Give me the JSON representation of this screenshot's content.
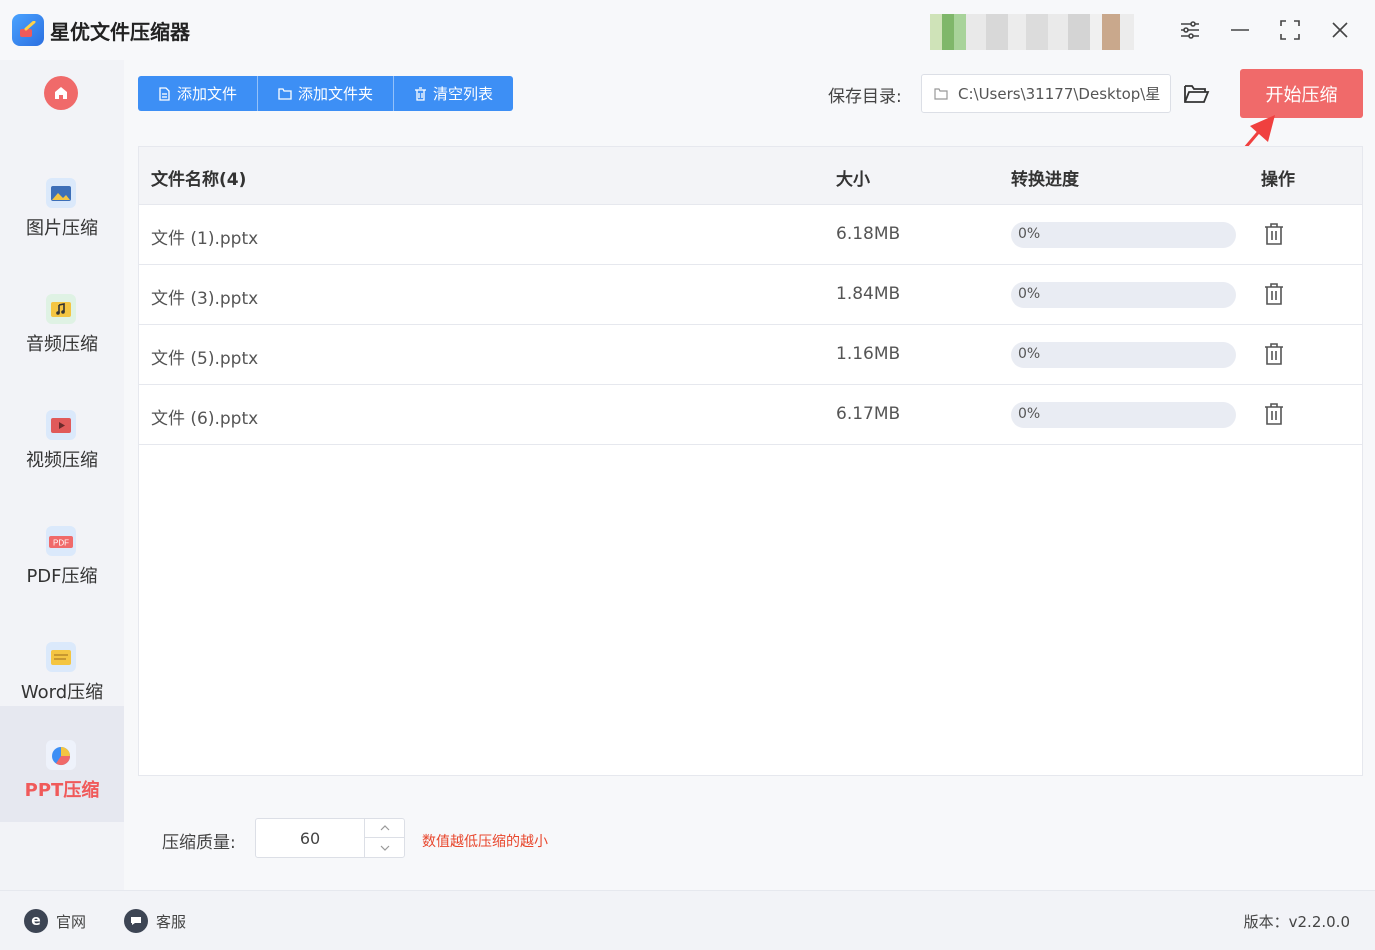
{
  "app": {
    "title": "星优文件压缩器"
  },
  "sidebar": {
    "items": [
      {
        "label": "图片压缩",
        "icon": "image-icon"
      },
      {
        "label": "音频压缩",
        "icon": "audio-icon"
      },
      {
        "label": "视频压缩",
        "icon": "video-icon"
      },
      {
        "label": "PDF压缩",
        "icon": "pdf-icon"
      },
      {
        "label": "Word压缩",
        "icon": "word-icon"
      },
      {
        "label": "PPT压缩",
        "icon": "ppt-icon",
        "active": true
      }
    ]
  },
  "toolbar": {
    "add_file": "添加文件",
    "add_folder": "添加文件夹",
    "clear_list": "清空列表"
  },
  "save": {
    "label": "保存目录:",
    "path": "C:\\Users\\31177\\Desktop\\星"
  },
  "start_button": "开始压缩",
  "table": {
    "headers": {
      "name": "文件名称(4)",
      "size": "大小",
      "progress": "转换进度",
      "action": "操作"
    },
    "rows": [
      {
        "name": "文件 (1).pptx",
        "size": "6.18MB",
        "progress": "0%",
        "progress_value": 0
      },
      {
        "name": "文件 (3).pptx",
        "size": "1.84MB",
        "progress": "0%",
        "progress_value": 0
      },
      {
        "name": "文件 (5).pptx",
        "size": "1.16MB",
        "progress": "0%",
        "progress_value": 0
      },
      {
        "name": "文件 (6).pptx",
        "size": "6.17MB",
        "progress": "0%",
        "progress_value": 0
      }
    ]
  },
  "quality": {
    "label": "压缩质量:",
    "value": "60",
    "hint": "数值越低压缩的越小"
  },
  "footer": {
    "website": "官网",
    "support": "客服",
    "version": "版本：v2.2.0.0"
  },
  "colors": {
    "accent": "#3d8ff5",
    "danger": "#f06a6a",
    "hint": "#e8472d"
  }
}
